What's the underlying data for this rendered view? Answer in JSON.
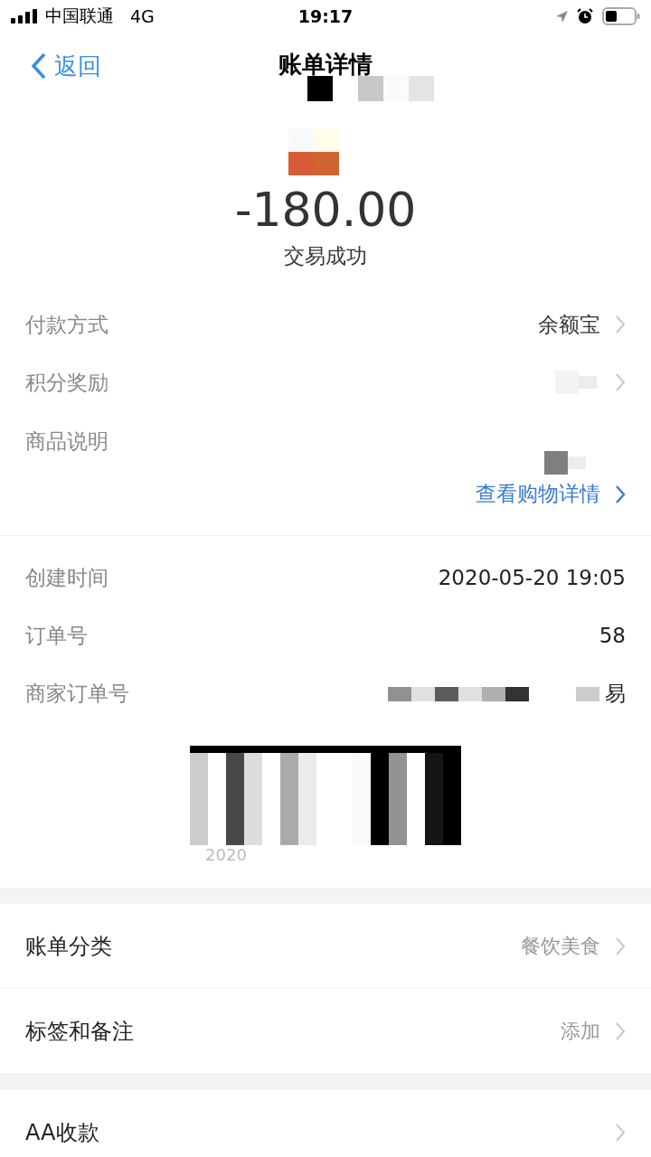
{
  "status_bar": {
    "carrier": "中国联通",
    "network": "4G",
    "time": "19:17"
  },
  "nav": {
    "back": "返回",
    "title": "账单详情"
  },
  "summary": {
    "amount": "-180.00",
    "status": "交易成功"
  },
  "info_rows": [
    {
      "kind": "value",
      "label": "付款方式",
      "value": "余额宝",
      "chevron": true
    },
    {
      "kind": "masked",
      "label": "积分奖励",
      "chevron": true
    },
    {
      "kind": "masked",
      "label": "商品说明",
      "chevron": false
    }
  ],
  "shopping_link": "查看购物详情",
  "detail_rows": [
    {
      "label": "创建时间",
      "value": "2020-05-20 19:05"
    },
    {
      "label": "订单号",
      "value": "58"
    },
    {
      "label": "商家订单号",
      "value": "易"
    }
  ],
  "barcode_caption": "2020",
  "menu_groups": [
    [
      {
        "label": "账单分类",
        "value": "餐饮美食"
      },
      {
        "label": "标签和备注",
        "value": "添加"
      }
    ],
    [
      {
        "label": "AA收款"
      }
    ]
  ]
}
